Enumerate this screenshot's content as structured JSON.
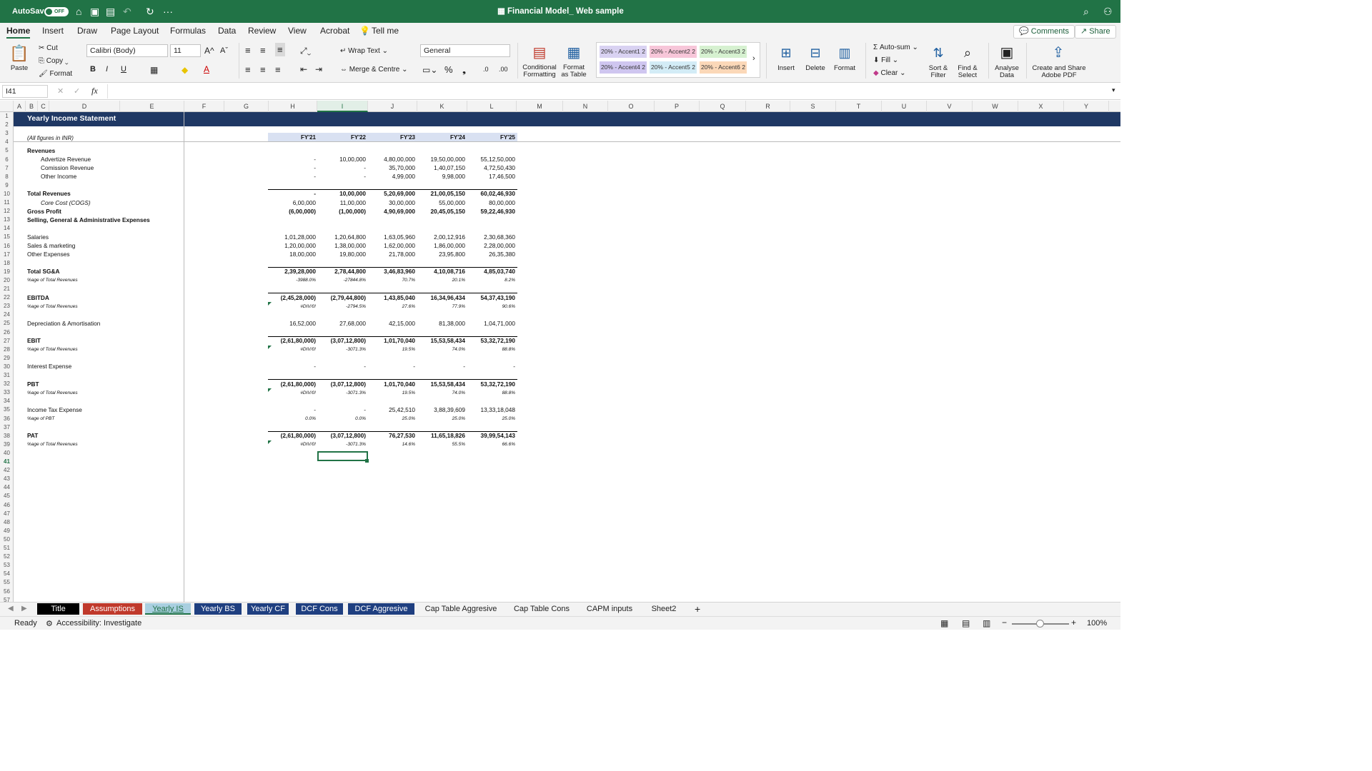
{
  "titlebar": {
    "autosave_label": "AutoSave",
    "toggle_state": "OFF",
    "doc_title": "Financial Model_ Web sample",
    "bg": "#217346"
  },
  "menu": {
    "tabs": [
      "Home",
      "Insert",
      "Draw",
      "Page Layout",
      "Formulas",
      "Data",
      "Review",
      "View",
      "Acrobat"
    ],
    "tell_me": "Tell me",
    "comments": "Comments",
    "share": "Share"
  },
  "ribbon": {
    "paste": "Paste",
    "cut": "Cut",
    "copy": "Copy",
    "format": "Format",
    "font_name": "Calibri (Body)",
    "font_size": "11",
    "bold": "B",
    "italic": "I",
    "underline": "U",
    "wrap_text": "Wrap Text",
    "merge_centre": "Merge & Centre",
    "number_format": "General",
    "conditional_formatting": "Conditional Formatting",
    "format_as_table": "Format as Table",
    "styles": [
      {
        "label": "20% - Accent1 2",
        "color": "#d9d2f2"
      },
      {
        "label": "20% - Accent2 2",
        "color": "#f7c6d9"
      },
      {
        "label": "20% - Accent3 2",
        "color": "#d6f1d0"
      },
      {
        "label": "20% - Accent4 2",
        "color": "#cfc6f0"
      },
      {
        "label": "20% - Accent5 2",
        "color": "#d3ecf6"
      },
      {
        "label": "20% - Accent6 2",
        "color": "#fbd8b8"
      }
    ],
    "insert": "Insert",
    "delete": "Delete",
    "format_cells": "Format",
    "autosum": "Auto-sum",
    "fill": "Fill",
    "clear": "Clear",
    "sort_filter": "Sort & Filter",
    "find_select": "Find & Select",
    "analyse_data": "Analyse Data",
    "create_share": "Create and Share Adobe PDF"
  },
  "formula_bar": {
    "name_box": "I41",
    "fx": "fx",
    "content": ""
  },
  "columns": [
    "A",
    "B",
    "C",
    "D",
    "E",
    "F",
    "G",
    "H",
    "I",
    "J",
    "K",
    "L",
    "M",
    "N",
    "O",
    "P",
    "Q",
    "R",
    "S",
    "T",
    "U",
    "V",
    "W",
    "X",
    "Y"
  ],
  "selected_cell": "I41",
  "sheet": {
    "title": "Yearly Income Statement",
    "units": "(All figures in INR)",
    "years": [
      "FY'21",
      "FY'22",
      "FY'23",
      "FY'24",
      "FY'25"
    ],
    "rows": [
      {
        "r": 5,
        "label": "Revenues",
        "bold": true,
        "values": null
      },
      {
        "r": 6,
        "label": "Advertize Revenue",
        "indent": true,
        "values": [
          "-",
          "10,00,000",
          "4,80,00,000",
          "19,50,00,000",
          "55,12,50,000"
        ]
      },
      {
        "r": 7,
        "label": "Comission Revenue",
        "indent": true,
        "values": [
          "-",
          "-",
          "35,70,000",
          "1,40,07,150",
          "4,72,50,430"
        ]
      },
      {
        "r": 8,
        "label": "Other Income",
        "indent": true,
        "values": [
          "-",
          "-",
          "4,99,000",
          "9,98,000",
          "17,46,500"
        ]
      },
      {
        "r": 10,
        "label": "Total Revenues",
        "bold": true,
        "topline": true,
        "values": [
          "-",
          "10,00,000",
          "5,20,69,000",
          "21,00,05,150",
          "60,02,46,930"
        ]
      },
      {
        "r": 11,
        "label": "Core Cost (COGS)",
        "italic": true,
        "indent": true,
        "values": [
          "6,00,000",
          "11,00,000",
          "30,00,000",
          "55,00,000",
          "80,00,000"
        ]
      },
      {
        "r": 12,
        "label": "Gross Profit",
        "bold": true,
        "values": [
          "(6,00,000)",
          "(1,00,000)",
          "4,90,69,000",
          "20,45,05,150",
          "59,22,46,930"
        ]
      },
      {
        "r": 13,
        "label": "Selling, General & Administrative Expenses",
        "bold": true,
        "values": null
      },
      {
        "r": 15,
        "label": "Salaries",
        "values": [
          "1,01,28,000",
          "1,20,64,800",
          "1,63,05,960",
          "2,00,12,916",
          "2,30,68,360"
        ]
      },
      {
        "r": 16,
        "label": "Sales & marketing",
        "values": [
          "1,20,00,000",
          "1,38,00,000",
          "1,62,00,000",
          "1,86,00,000",
          "2,28,00,000"
        ]
      },
      {
        "r": 17,
        "label": "Other Expenses",
        "values": [
          "18,00,000",
          "19,80,000",
          "21,78,000",
          "23,95,800",
          "26,35,380"
        ]
      },
      {
        "r": 19,
        "label": "Total SG&A",
        "bold": true,
        "topline": true,
        "values": [
          "2,39,28,000",
          "2,78,44,800",
          "3,46,83,960",
          "4,10,08,716",
          "4,85,03,740"
        ]
      },
      {
        "r": 20,
        "label": "%age of Total Revenues",
        "pct": true,
        "values": [
          "-3988.0%",
          "-27844.8%",
          "70.7%",
          "20.1%",
          "8.2%"
        ]
      },
      {
        "r": 22,
        "label": "EBITDA",
        "bold": true,
        "topline": true,
        "values": [
          "(2,45,28,000)",
          "(2,79,44,800)",
          "1,43,85,040",
          "16,34,96,434",
          "54,37,43,190"
        ]
      },
      {
        "r": 23,
        "label": "%age of Total Revenues",
        "pct": true,
        "err": true,
        "values": [
          "#DIV/0!",
          "-2794.5%",
          "27.6%",
          "77.9%",
          "90.6%"
        ]
      },
      {
        "r": 25,
        "label": "Depreciation & Amortisation",
        "values": [
          "16,52,000",
          "27,68,000",
          "42,15,000",
          "81,38,000",
          "1,04,71,000"
        ]
      },
      {
        "r": 27,
        "label": "EBIT",
        "bold": true,
        "topline": true,
        "values": [
          "(2,61,80,000)",
          "(3,07,12,800)",
          "1,01,70,040",
          "15,53,58,434",
          "53,32,72,190"
        ]
      },
      {
        "r": 28,
        "label": "%age of Total Revenues",
        "pct": true,
        "err": true,
        "values": [
          "#DIV/0!",
          "-3071.3%",
          "19.5%",
          "74.0%",
          "88.8%"
        ]
      },
      {
        "r": 30,
        "label": "Interest Expense",
        "values": [
          "-",
          "-",
          "-",
          "-",
          "-"
        ]
      },
      {
        "r": 32,
        "label": "PBT",
        "bold": true,
        "topline": true,
        "values": [
          "(2,61,80,000)",
          "(3,07,12,800)",
          "1,01,70,040",
          "15,53,58,434",
          "53,32,72,190"
        ]
      },
      {
        "r": 33,
        "label": "%age of Total Revenues",
        "pct": true,
        "err": true,
        "values": [
          "#DIV/0!",
          "-3071.3%",
          "19.5%",
          "74.0%",
          "88.8%"
        ]
      },
      {
        "r": 35,
        "label": "Income Tax Expense",
        "values": [
          "-",
          "-",
          "25,42,510",
          "3,88,39,609",
          "13,33,18,048"
        ]
      },
      {
        "r": 36,
        "label": "%age of PBT",
        "pct": true,
        "values": [
          "0.0%",
          "0.0%",
          "25.0%",
          "25.0%",
          "25.0%"
        ]
      },
      {
        "r": 38,
        "label": "PAT",
        "bold": true,
        "topline": true,
        "values": [
          "(2,61,80,000)",
          "(3,07,12,800)",
          "76,27,530",
          "11,65,18,826",
          "39,99,54,143"
        ]
      },
      {
        "r": 39,
        "label": "%age of Total Revenues",
        "pct": true,
        "err": true,
        "values": [
          "#DIV/0!",
          "-3071.3%",
          "14.6%",
          "55.5%",
          "66.6%"
        ]
      }
    ]
  },
  "sheet_tabs": [
    {
      "name": "Title",
      "bg": "#000000",
      "fg": "#ffffff"
    },
    {
      "name": "Assumptions",
      "bg": "#c0392b",
      "fg": "#ffffff"
    },
    {
      "name": "Yearly IS",
      "bg": "#a9cfe0",
      "fg": "#217346",
      "active": true
    },
    {
      "name": "Yearly BS",
      "bg": "#1f3f80",
      "fg": "#ffffff"
    },
    {
      "name": "Yearly CF",
      "bg": "#1f3f80",
      "fg": "#ffffff"
    },
    {
      "name": "DCF Cons",
      "bg": "#1f3f80",
      "fg": "#ffffff"
    },
    {
      "name": "DCF Aggresive",
      "bg": "#1f3f80",
      "fg": "#ffffff"
    },
    {
      "name": "Cap Table Aggresive",
      "bg": "",
      "fg": "#222222"
    },
    {
      "name": "Cap Table Cons",
      "bg": "",
      "fg": "#222222"
    },
    {
      "name": "CAPM inputs",
      "bg": "",
      "fg": "#222222"
    },
    {
      "name": "Sheet2",
      "bg": "",
      "fg": "#222222"
    }
  ],
  "status": {
    "ready": "Ready",
    "accessibility": "Accessibility: Investigate",
    "zoom": "100%"
  }
}
